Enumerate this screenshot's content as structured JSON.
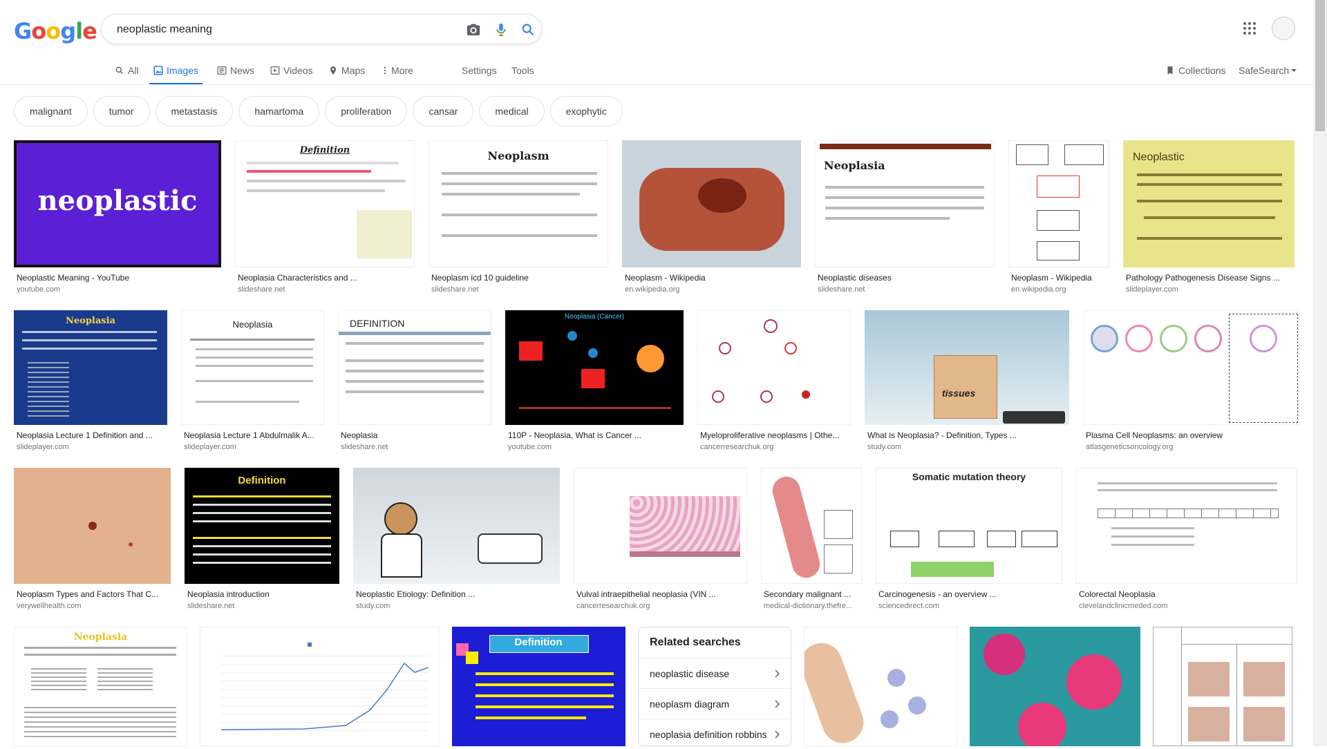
{
  "logo": [
    "G",
    "o",
    "o",
    "g",
    "l",
    "e"
  ],
  "search": {
    "query": "neoplastic meaning"
  },
  "tabs": [
    {
      "label": "All"
    },
    {
      "label": "Images"
    },
    {
      "label": "News"
    },
    {
      "label": "Videos"
    },
    {
      "label": "Maps"
    },
    {
      "label": "More"
    },
    {
      "label": "Settings"
    },
    {
      "label": "Tools"
    }
  ],
  "right_tabs": {
    "collections": "Collections",
    "safesearch": "SafeSearch"
  },
  "chips": [
    "malignant",
    "tumor",
    "metastasis",
    "hamartoma",
    "proliferation",
    "cansar",
    "medical",
    "exophytic"
  ],
  "rows": [
    [
      {
        "caption": "Neoplastic Meaning - YouTube",
        "source": "youtube.com",
        "img": {
          "title": "neoplastic",
          "bg": "#5b1fd6"
        }
      },
      {
        "caption": "Neoplasia Characteristics and ...",
        "source": "slideshare.net",
        "img": {
          "title": "Definition",
          "bg": "#ffffff"
        }
      },
      {
        "caption": "Neoplasm icd 10 guideline",
        "source": "slideshare.net",
        "img": {
          "title": "Neoplasm",
          "bg": "#ffffff"
        }
      },
      {
        "caption": "Neoplasm - Wikipedia",
        "source": "en.wikipedia.org",
        "img": {
          "title": "",
          "bg": "#c8a090"
        }
      },
      {
        "caption": "Neoplastic diseases",
        "source": "slideshare.net",
        "img": {
          "title": "Neoplasia",
          "bg": "#ffffff"
        }
      },
      {
        "caption": "Neoplasm - Wikipedia",
        "source": "en.wikipedia.org",
        "img": {
          "title": "",
          "bg": "#ffffff"
        }
      },
      {
        "caption": "Pathology Pathogenesis Disease Signs ...",
        "source": "slideplayer.com",
        "img": {
          "title": "Neoplastic",
          "bg": "#e8e48a"
        }
      }
    ],
    [
      {
        "caption": "Neoplasia Lecture 1 Definition and ...",
        "source": "slideplayer.com",
        "img": {
          "title": "Neoplasia",
          "bg": "#1a3a8c"
        }
      },
      {
        "caption": "Neoplasia Lecture 1 Abdulmalik A...",
        "source": "slideplayer.com",
        "img": {
          "title": "Neoplasia",
          "bg": "#ffffff"
        }
      },
      {
        "caption": "Neoplasia",
        "source": "slideshare.net",
        "img": {
          "title": "DEFINITION",
          "bg": "#ffffff"
        }
      },
      {
        "caption": "110P - Neoplasia, What is Cancer ...",
        "source": "youtube.com",
        "img": {
          "title": "Neoplasia (Cancer)",
          "bg": "#000000"
        }
      },
      {
        "caption": "Myeloproliferative neoplasms | Othe...",
        "source": "cancerresearchuk.org",
        "img": {
          "title": "",
          "bg": "#ffffff"
        }
      },
      {
        "caption": "What is Neoplasia? - Definition, Types ...",
        "source": "study.com",
        "img": {
          "title": "tissues",
          "bg": "#a8c8d8"
        }
      },
      {
        "caption": "Plasma Cell Neoplasms: an overview",
        "source": "atlasgeneticsoncology.org",
        "img": {
          "title": "",
          "bg": "#ffffff"
        }
      }
    ],
    [
      {
        "caption": "Neoplasm Types and Factors That C...",
        "source": "verywellhealth.com",
        "img": {
          "title": "",
          "bg": "#e2b28e"
        }
      },
      {
        "caption": "Neoplasia introduction",
        "source": "slideshare.net",
        "img": {
          "title": "Definition",
          "bg": "#000000"
        }
      },
      {
        "caption": "Neoplastic Etiology: Definition ...",
        "source": "study.com",
        "img": {
          "title": "",
          "bg": "#e8ecef"
        }
      },
      {
        "caption": "Vulval intraepithelial neoplasia (VIN ...",
        "source": "cancerresearchuk.org",
        "img": {
          "title": "",
          "bg": "#ffffff"
        }
      },
      {
        "caption": "Secondary malignant ...",
        "source": "medical-dictionary.thefre...",
        "img": {
          "title": "",
          "bg": "#ffffff"
        }
      },
      {
        "caption": "Carcinogenesis - an overview ...",
        "source": "sciencedirect.com",
        "img": {
          "title": "Somatic mutation theory",
          "bg": "#ffffff"
        }
      },
      {
        "caption": "Colorectal Neoplasia",
        "source": "clevelandclinicmeded.com",
        "img": {
          "title": "",
          "bg": "#ffffff"
        }
      }
    ]
  ],
  "row4": [
    {
      "img": {
        "title": "Neoplasia",
        "bg": "#ffffff"
      }
    },
    {
      "img": {
        "title": "",
        "bg": "#ffffff"
      }
    },
    {
      "img": {
        "title": "Definition",
        "bg": "#1d1dd6"
      }
    },
    {
      "img": {
        "title": "",
        "bg": "#ffffff"
      }
    },
    {
      "img": {
        "title": "",
        "bg": "#2a9aa0"
      }
    },
    {
      "img": {
        "title": "",
        "bg": "#ffffff"
      }
    }
  ],
  "related": {
    "title": "Related searches",
    "items": [
      "neoplastic disease",
      "neoplasm diagram",
      "neoplasia definition robbins"
    ]
  }
}
